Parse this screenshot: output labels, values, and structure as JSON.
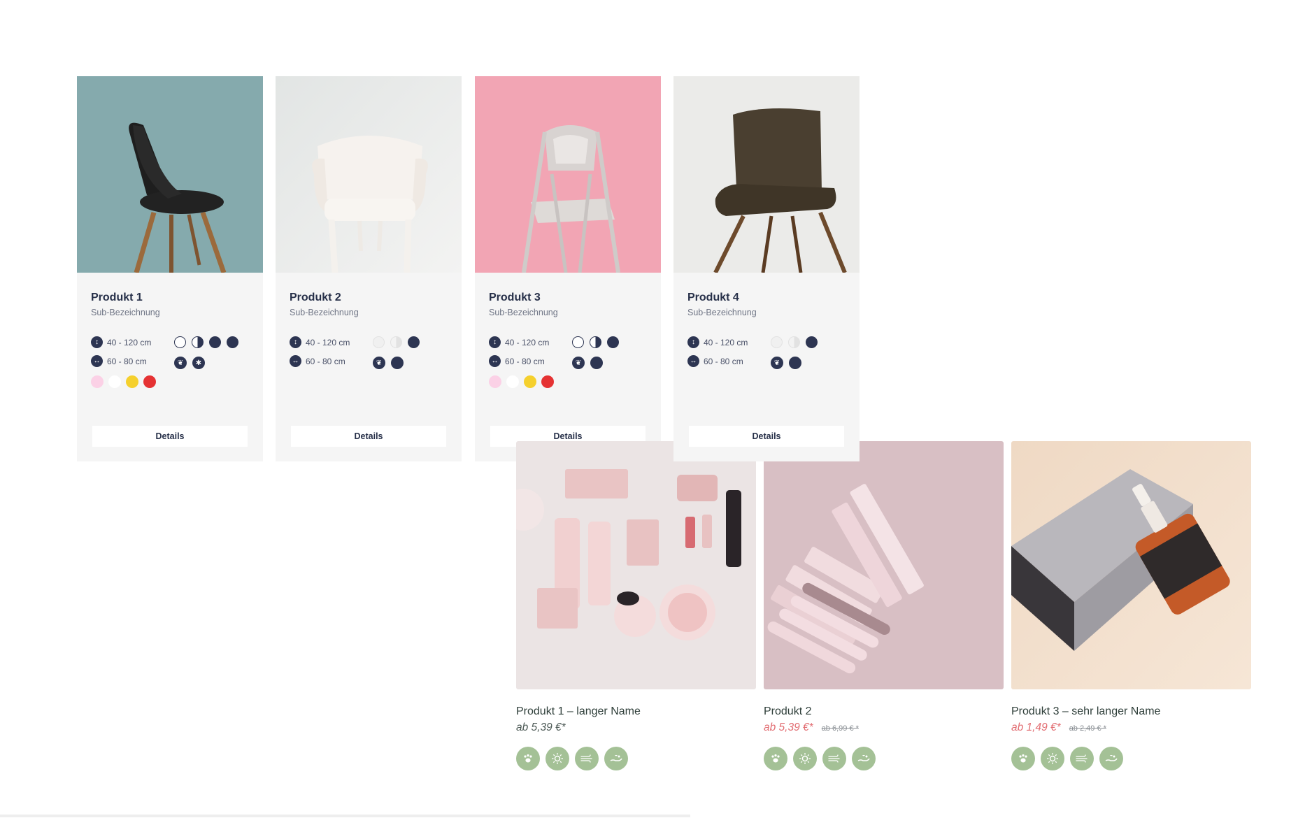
{
  "chairs": [
    {
      "name": "Produkt 1",
      "sub": "Sub-Bezeichnung",
      "height_range": "40 - 120 cm",
      "width_range": "60 - 80 cm",
      "details_label": "Details",
      "colors": [
        "#fbd1e6",
        "#ffffff",
        "#f5d02d",
        "#e53233"
      ]
    },
    {
      "name": "Produkt 2",
      "sub": "Sub-Bezeichnung",
      "height_range": "40 - 120 cm",
      "width_range": "60 - 80 cm",
      "details_label": "Details",
      "colors": []
    },
    {
      "name": "Produkt 3",
      "sub": "Sub-Bezeichnung",
      "height_range": "40 - 120 cm",
      "width_range": "60 - 80 cm",
      "details_label": "Details",
      "colors": [
        "#fbd1e6",
        "#ffffff",
        "#f5d02d",
        "#e53233"
      ]
    },
    {
      "name": "Produkt 4",
      "sub": "Sub-Bezeichnung",
      "height_range": "40 - 120 cm",
      "width_range": "60 - 80 cm",
      "details_label": "Details",
      "colors": []
    }
  ],
  "cosmetics": [
    {
      "name": "Produkt 1 – langer Name",
      "price": "ab 5,39 €*",
      "old_price": "",
      "price_color": "#4d5a56"
    },
    {
      "name": "Produkt 2",
      "price": "ab 5,39 €*",
      "old_price": "ab 6,99 € *",
      "price_color": "#e26d72"
    },
    {
      "name": "Produkt 3 – sehr langer Name",
      "price": "ab 1,49 €*",
      "old_price": "ab 2,49 € *",
      "price_color": "#e26d72"
    }
  ],
  "feature_icons": [
    "paw-icon",
    "sun-icon",
    "wind-icon",
    "hand-care-icon"
  ],
  "theme": {
    "navy": "#2d3552",
    "sage": "#a4c196",
    "sale_red": "#e26d72",
    "card_bg": "#f5f5f5"
  }
}
